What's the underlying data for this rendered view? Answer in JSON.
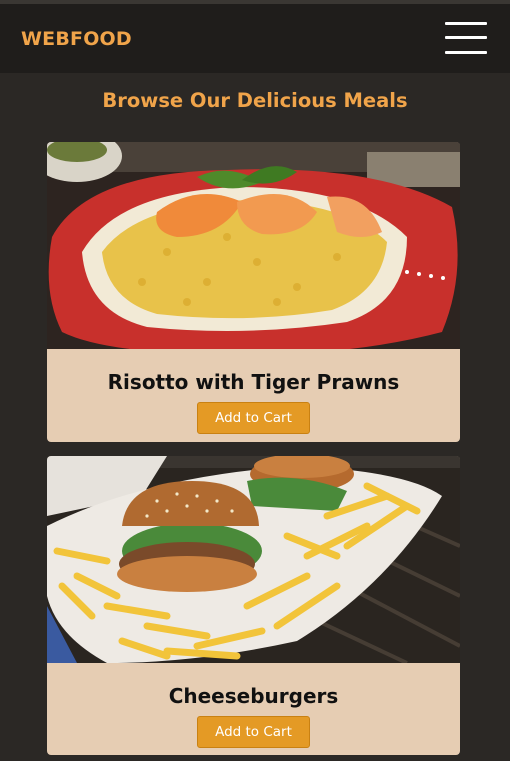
{
  "navbar": {
    "brand": "WEBFOOD",
    "menu_icon": "hamburger-menu-icon"
  },
  "page": {
    "heading": "Browse Our Delicious Meals"
  },
  "meals": [
    {
      "name": "Risotto with Tiger Prawns",
      "button_label": "Add to Cart",
      "image": "risotto-prawns-photo"
    },
    {
      "name": "Cheeseburgers",
      "button_label": "Add to Cart",
      "image": "cheeseburgers-fries-photo"
    }
  ],
  "colors": {
    "background": "#2b2825",
    "navbar": "#1f1d1b",
    "accent": "#f0a44a",
    "card": "#e6cdb3",
    "button": "#e49a25"
  }
}
